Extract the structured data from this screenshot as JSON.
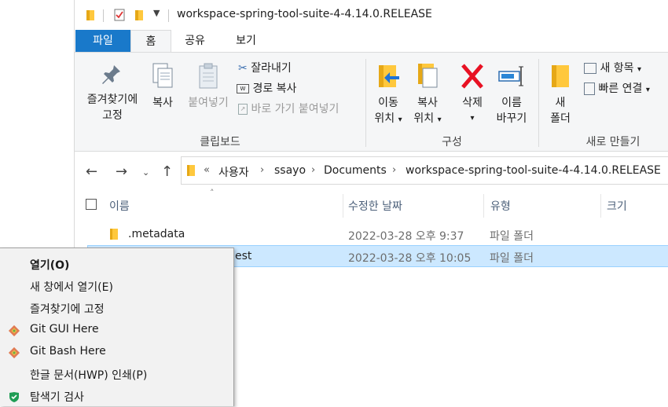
{
  "window": {
    "title": "workspace-spring-tool-suite-4-4.14.0.RELEASE"
  },
  "ribbon_tabs": [
    "파일",
    "홈",
    "공유",
    "보기"
  ],
  "ribbon": {
    "clipboard": {
      "pin_line1": "즐겨찾기에",
      "pin_line2": "고정",
      "copy": "복사",
      "paste": "붙여넣기",
      "cut": "잘라내기",
      "copy_path": "경로 복사",
      "paste_shortcut": "바로 가기 붙여넣기",
      "group_label": "클립보드"
    },
    "organize": {
      "move_line1": "이동",
      "move_line2": "위치",
      "copy_line1": "복사",
      "copy_line2": "위치",
      "delete": "삭제",
      "rename_line1": "이름",
      "rename_line2": "바꾸기",
      "group_label": "구성"
    },
    "new": {
      "new_folder_line1": "새",
      "new_folder_line2": "폴더",
      "new_item": "새 항목",
      "easy_access": "빠른 연결",
      "group_label": "새로 만들기"
    }
  },
  "address": {
    "overflow": "«",
    "crumbs": [
      "사용자",
      "ssayo",
      "Documents",
      "workspace-spring-tool-suite-4-4.14.0.RELEASE"
    ]
  },
  "columns": [
    "이름",
    "수정한 날짜",
    "유형",
    "크기"
  ],
  "files": [
    {
      "name": ".metadata",
      "modified": "2022-03-28 오후 9:37",
      "type": "파일 폴더"
    },
    {
      "name": "est",
      "modified": "2022-03-28 오후 10:05",
      "type": "파일 폴더"
    }
  ],
  "context_menu": [
    {
      "label": "열기(O)",
      "icon": ""
    },
    {
      "label": "새 창에서 열기(E)",
      "icon": ""
    },
    {
      "label": "즐겨찾기에 고정",
      "icon": ""
    },
    {
      "label": "Git GUI Here",
      "icon": "git-icon"
    },
    {
      "label": "Git Bash Here",
      "icon": "git-icon"
    },
    {
      "label": "한글 문서(HWP) 인쇄(P)",
      "icon": ""
    },
    {
      "label": "탐색기 검사",
      "icon": "shield-icon"
    }
  ],
  "colors": {
    "file_tab": "#1979ca",
    "selection": "#cce8ff",
    "folder": "#ffc83d",
    "delete_red": "#e81123"
  }
}
